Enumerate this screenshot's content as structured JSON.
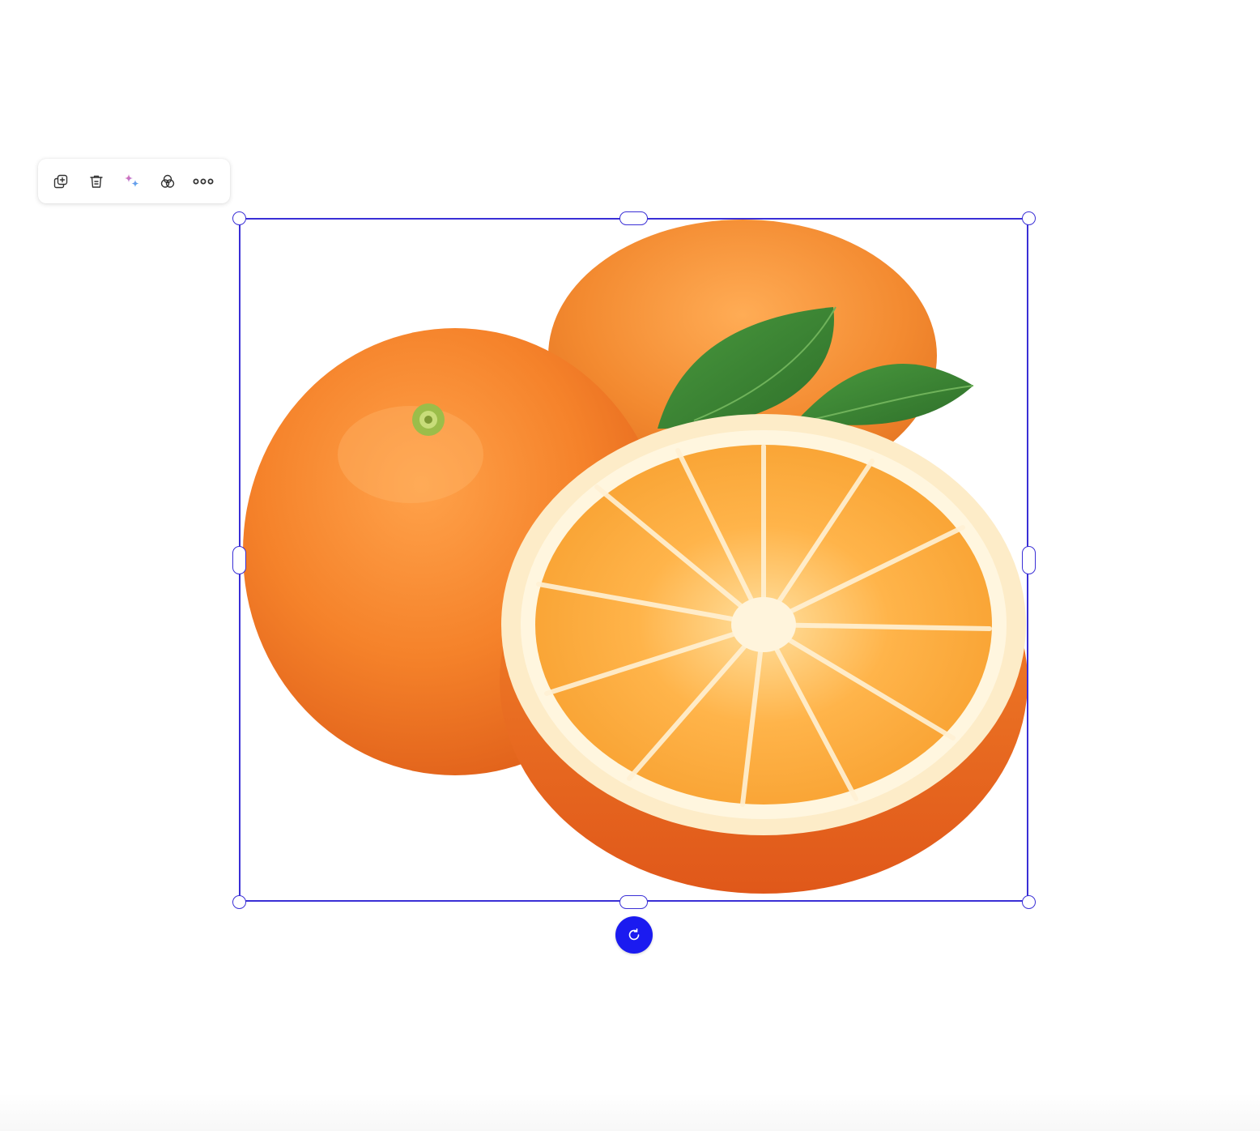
{
  "toolbar": {
    "items": [
      {
        "name": "duplicate",
        "icon": "duplicate-icon"
      },
      {
        "name": "delete",
        "icon": "trash-icon"
      },
      {
        "name": "ai-edit",
        "icon": "sparkle-icon"
      },
      {
        "name": "effects",
        "icon": "blend-icon"
      },
      {
        "name": "more",
        "icon": "more-horizontal-icon"
      }
    ]
  },
  "selection": {
    "color": "#3a2fd6",
    "rotate_button_color": "#1b1bf0",
    "content": "oranges-image"
  },
  "colors": {
    "orange_peel": "#f08a2a",
    "orange_flesh": "#f9a640",
    "pith": "#fdf1d8",
    "leaf": "#3f8a36"
  }
}
